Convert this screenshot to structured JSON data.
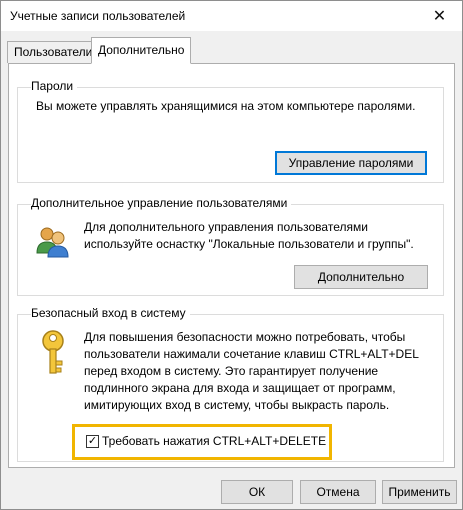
{
  "window": {
    "title": "Учетные записи пользователей"
  },
  "tabs": [
    {
      "label": "Пользователи",
      "selected": false
    },
    {
      "label": "Дополнительно",
      "selected": true
    }
  ],
  "passwords": {
    "title": "Пароли",
    "text": "Вы можете управлять хранящимися на этом компьютере паролями.",
    "button": "Управление паролями"
  },
  "advanced_users": {
    "title": "Дополнительное управление пользователями",
    "text_line1": "Для дополнительного управления пользователями",
    "text_line2": "используйте оснастку \"Локальные пользователи и группы\".",
    "button": "Дополнительно"
  },
  "secure_logon": {
    "title": "Безопасный вход в систему",
    "text_lines": [
      "Для повышения безопасности можно потребовать, чтобы",
      "пользователи нажимали сочетание клавиш CTRL+ALT+DEL",
      "перед входом в систему. Это гарантирует получение",
      "подлинного экрана для входа и защищает от программ,",
      "имитирующих вход в систему, чтобы выкрасть пароль."
    ],
    "checkbox_label": "Требовать нажатия CTRL+ALT+DELETE",
    "checkbox_checked": true
  },
  "footer": {
    "ok": "ОК",
    "cancel": "Отмена",
    "apply": "Применить"
  },
  "icons": {
    "close": "close-icon",
    "users": "users-icon",
    "key": "key-icon"
  },
  "colors": {
    "highlight": "#f1b500",
    "focus": "#0078d7"
  }
}
